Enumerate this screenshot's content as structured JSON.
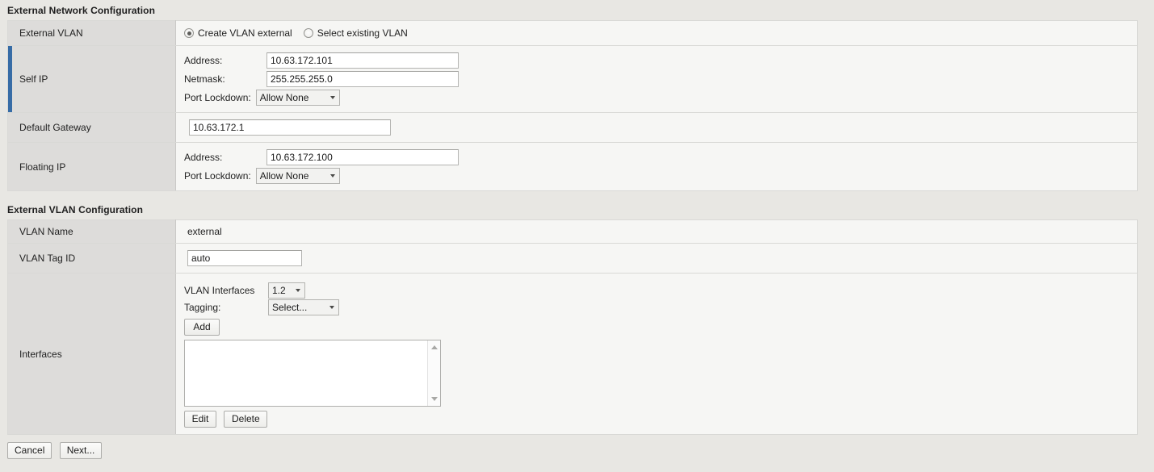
{
  "sections": {
    "external_network": {
      "title": "External Network Configuration",
      "rows": {
        "external_vlan": {
          "label": "External VLAN",
          "radios": [
            {
              "label": "Create VLAN external",
              "selected": true
            },
            {
              "label": "Select existing VLAN",
              "selected": false
            }
          ]
        },
        "self_ip": {
          "label": "Self IP",
          "address_label": "Address:",
          "address_value": "10.63.172.101",
          "netmask_label": "Netmask:",
          "netmask_value": "255.255.255.0",
          "port_lockdown_label": "Port Lockdown:",
          "port_lockdown_value": "Allow None"
        },
        "default_gateway": {
          "label": "Default Gateway",
          "value": "10.63.172.1"
        },
        "floating_ip": {
          "label": "Floating IP",
          "address_label": "Address:",
          "address_value": "10.63.172.100",
          "port_lockdown_label": "Port Lockdown:",
          "port_lockdown_value": "Allow None"
        }
      }
    },
    "external_vlan": {
      "title": "External VLAN Configuration",
      "rows": {
        "vlan_name": {
          "label": "VLAN Name",
          "value": "external"
        },
        "vlan_tag_id": {
          "label": "VLAN Tag ID",
          "value": "auto"
        },
        "interfaces": {
          "label": "Interfaces",
          "vlan_interfaces_label": "VLAN Interfaces",
          "vlan_interfaces_value": "1.2",
          "tagging_label": "Tagging:",
          "tagging_value": "Select...",
          "add_label": "Add",
          "list_items": [],
          "edit_label": "Edit",
          "delete_label": "Delete"
        }
      }
    }
  },
  "footer": {
    "cancel_label": "Cancel",
    "next_label": "Next..."
  },
  "colors": {
    "accent_blue": "#376ca6",
    "label_cell_bg": "#dddcda",
    "content_cell_bg": "#f6f6f4",
    "page_bg": "#e8e7e3"
  },
  "icons": {
    "dropdown_caret": "chevron-down-icon",
    "scroll_up": "scroll-up-arrow-icon",
    "scroll_down": "scroll-down-arrow-icon"
  }
}
